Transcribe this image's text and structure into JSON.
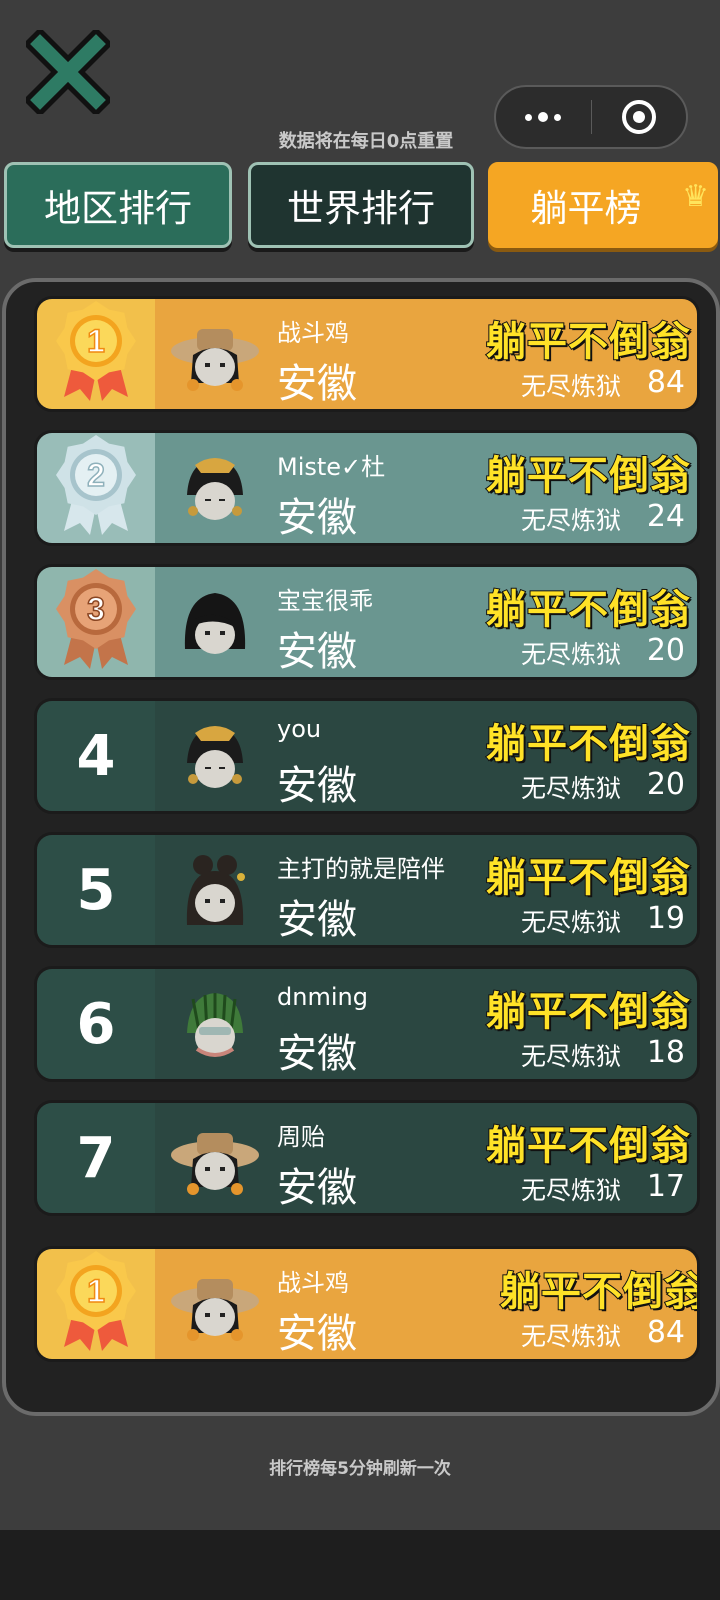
{
  "header": {
    "reset_note": "数据将在每日0点重置"
  },
  "tabs": {
    "region": "地区排行",
    "world": "世界排行",
    "flat": "躺平榜"
  },
  "colors": {
    "gold": "#e9a53f",
    "teal_dark": "#2b4741",
    "title_yellow": "#ffe227"
  },
  "rows": [
    {
      "rank": "1",
      "nick": "战斗鸡",
      "region": "安徽",
      "title": "躺平不倒翁",
      "mode": "无尽炼狱",
      "score": "84",
      "avatar": "straw-hat-girl-avatar"
    },
    {
      "rank": "2",
      "nick": "Miste✓杜",
      "region": "安徽",
      "title": "躺平不倒翁",
      "mode": "无尽炼狱",
      "score": "24",
      "avatar": "ornate-hair-avatar"
    },
    {
      "rank": "3",
      "nick": "宝宝很乖",
      "region": "安徽",
      "title": "躺平不倒翁",
      "mode": "无尽炼狱",
      "score": "20",
      "avatar": "dark-hair-avatar"
    },
    {
      "rank": "4",
      "nick": "you",
      "region": "安徽",
      "title": "躺平不倒翁",
      "mode": "无尽炼狱",
      "score": "20",
      "avatar": "ornate-hair-avatar"
    },
    {
      "rank": "5",
      "nick": "主打的就是陪伴",
      "region": "安徽",
      "title": "躺平不倒翁",
      "mode": "无尽炼狱",
      "score": "19",
      "avatar": "bun-hair-avatar"
    },
    {
      "rank": "6",
      "nick": "dnming",
      "region": "安徽",
      "title": "躺平不倒翁",
      "mode": "无尽炼狱",
      "score": "18",
      "avatar": "melon-helmet-avatar"
    },
    {
      "rank": "7",
      "nick": "周贻",
      "region": "安徽",
      "title": "躺平不倒翁",
      "mode": "无尽炼狱",
      "score": "17",
      "avatar": "straw-hat-girl-avatar"
    }
  ],
  "self_row": {
    "rank": "1",
    "nick": "战斗鸡",
    "region": "安徽",
    "title": "躺平不倒翁",
    "mode": "无尽炼狱",
    "score": "84",
    "avatar": "straw-hat-girl-avatar"
  },
  "footer": {
    "refresh_note": "排行榜每5分钟刷新一次"
  }
}
